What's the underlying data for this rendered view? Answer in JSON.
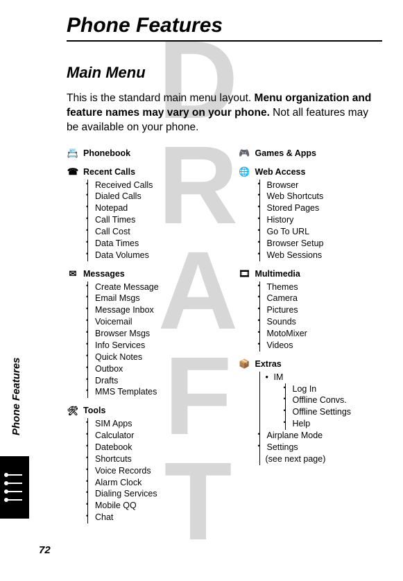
{
  "watermark": [
    "D",
    "R",
    "A",
    "F",
    "T"
  ],
  "page_title": "Phone Features",
  "section_title": "Main Menu",
  "intro_plain1": "This is the standard main menu layout. ",
  "intro_bold": "Menu organization and feature names may vary on your phone.",
  "intro_plain2": " Not all features may be available on your phone.",
  "left": [
    {
      "icon": "📇",
      "label": "Phonebook",
      "items": []
    },
    {
      "icon": "☎",
      "label": "Recent Calls",
      "items": [
        "Received Calls",
        "Dialed Calls",
        "Notepad",
        "Call Times",
        "Call Cost",
        "Data Times",
        "Data Volumes"
      ]
    },
    {
      "icon": "✉",
      "label": "Messages",
      "items": [
        "Create Message",
        "Email Msgs",
        "Message Inbox",
        "Voicemail",
        "Browser Msgs",
        "Info Services",
        "Quick Notes",
        "Outbox",
        "Drafts",
        "MMS Templates"
      ]
    },
    {
      "icon": "🛠",
      "label": "Tools",
      "items": [
        "SIM Apps",
        "Calculator",
        "Datebook",
        "Shortcuts",
        "Voice Records",
        "Alarm Clock",
        "Dialing Services",
        "Mobile QQ",
        "Chat"
      ]
    }
  ],
  "right": [
    {
      "icon": "🎮",
      "label": "Games & Apps",
      "items": []
    },
    {
      "icon": "🌐",
      "label": "Web Access",
      "items": [
        "Browser",
        "Web Shortcuts",
        "Stored Pages",
        "History",
        "Go To URL",
        "Browser Setup",
        "Web Sessions"
      ]
    },
    {
      "icon": "🎞",
      "label": "Multimedia",
      "items": [
        "Themes",
        "Camera",
        "Pictures",
        "Sounds",
        "MotoMixer",
        "Videos"
      ]
    }
  ],
  "extras": {
    "icon": "📦",
    "label": "Extras",
    "im_label": "IM",
    "im_items": [
      "Log In",
      "Offline Convs.",
      "Offline Settings",
      "Help"
    ],
    "tail": [
      "Airplane Mode",
      "Settings",
      "(see next page)"
    ]
  },
  "sidebar": "Phone Features",
  "page_number": "72"
}
